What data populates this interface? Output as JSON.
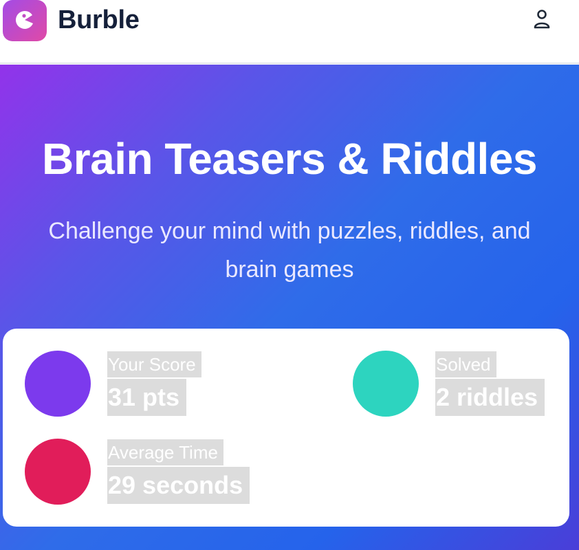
{
  "app": {
    "name": "Burble",
    "logo_icon": "pacman-chat-icon",
    "user_icon": "user-icon"
  },
  "hero": {
    "title": "Brain Teasers & Riddles",
    "subtitle_line1": "Challenge your mind with puzzles, riddles, and",
    "subtitle_line2": "brain games"
  },
  "stats": [
    {
      "label": "Your Score",
      "value": "31 pts",
      "color": "#7c3aed"
    },
    {
      "label": "Solved",
      "value": "2 riddles",
      "color": "#2dd4bf"
    },
    {
      "label": "Average Time",
      "value": "29 seconds",
      "color": "#e11d5a"
    }
  ],
  "colors": {
    "brand_text": "#15203a",
    "gradient_start": "#9233ea",
    "gradient_end": "#2563eb"
  }
}
